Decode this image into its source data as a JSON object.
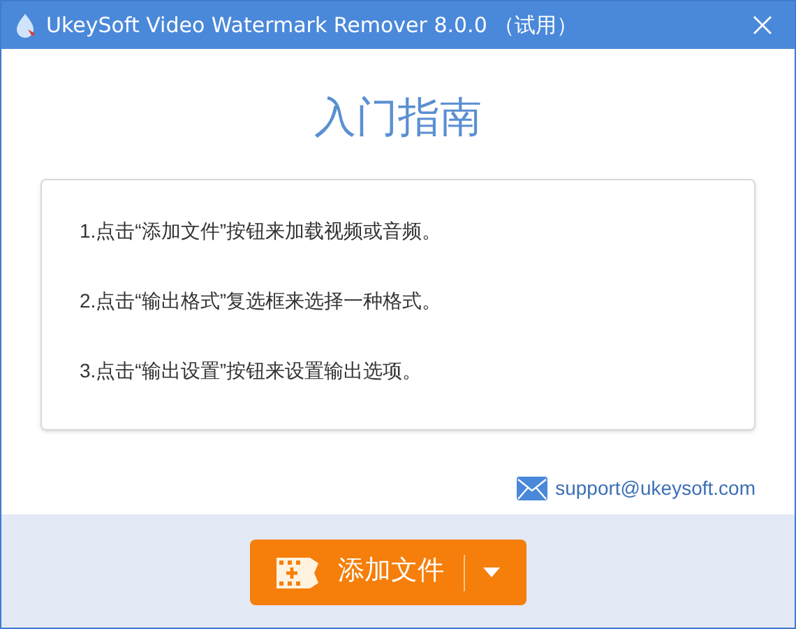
{
  "window": {
    "title": "UkeySoft Video Watermark Remover 8.0.0 （试用）"
  },
  "heading": "入门指南",
  "steps": [
    "1.点击“添加文件”按钮来加载视频或音频。",
    "2.点击“输出格式”复选框来选择一种格式。",
    "3.点击“输出设置”按钮来设置输出选项。"
  ],
  "support_email": "support@ukeysoft.com",
  "add_button": {
    "label": "添加文件"
  }
}
